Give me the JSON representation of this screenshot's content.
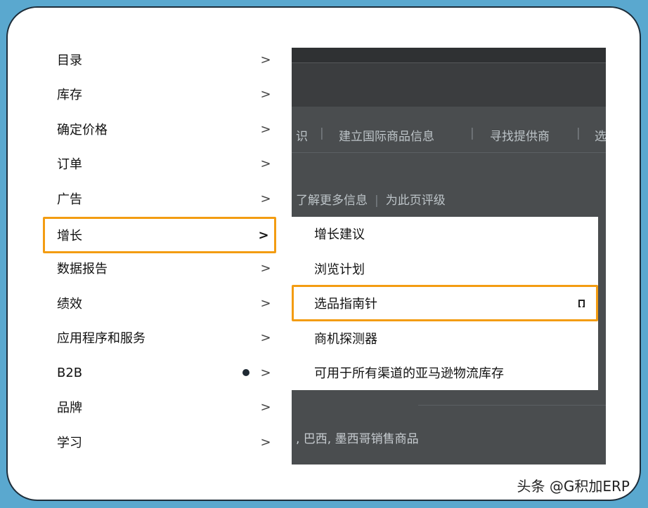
{
  "colors": {
    "highlight": "#f39c12",
    "frame_border": "#1d2d3a",
    "background": "#5aa8cf",
    "overlay": "#4a4d4f"
  },
  "menu": {
    "items": [
      {
        "label": "目录",
        "icon": "chevron-right-icon"
      },
      {
        "label": "库存",
        "icon": "chevron-right-icon"
      },
      {
        "label": "确定价格",
        "icon": "chevron-right-icon"
      },
      {
        "label": "订单",
        "icon": "chevron-right-icon"
      },
      {
        "label": "广告",
        "icon": "chevron-right-icon"
      },
      {
        "label": "增长",
        "icon": "chevron-right-icon",
        "active": true
      },
      {
        "label": "数据报告",
        "icon": "chevron-right-icon"
      },
      {
        "label": "绩效",
        "icon": "chevron-right-icon"
      },
      {
        "label": "应用程序和服务",
        "icon": "chevron-right-icon"
      },
      {
        "label": "B2B",
        "icon": "chevron-right-icon",
        "badge": "new-dot"
      },
      {
        "label": "品牌",
        "icon": "chevron-right-icon"
      },
      {
        "label": "学习",
        "icon": "chevron-right-icon"
      }
    ],
    "chevron": ">"
  },
  "submenu": {
    "items": [
      {
        "label": "增长建议"
      },
      {
        "label": "浏览计划"
      },
      {
        "label": "选品指南针",
        "active": true,
        "icon": "bookmark-icon"
      },
      {
        "label": "商机探测器"
      },
      {
        "label": "可用于所有渠道的亚马逊物流库存"
      }
    ]
  },
  "background_page": {
    "tabs": [
      "识",
      "建立国际商品信息",
      "寻找提供商",
      "选"
    ],
    "separator": "|",
    "links": [
      "了解更多信息",
      "为此页评级"
    ],
    "note": ", 巴西, 墨西哥销售商品"
  },
  "watermark": "头条 @G积加ERP"
}
